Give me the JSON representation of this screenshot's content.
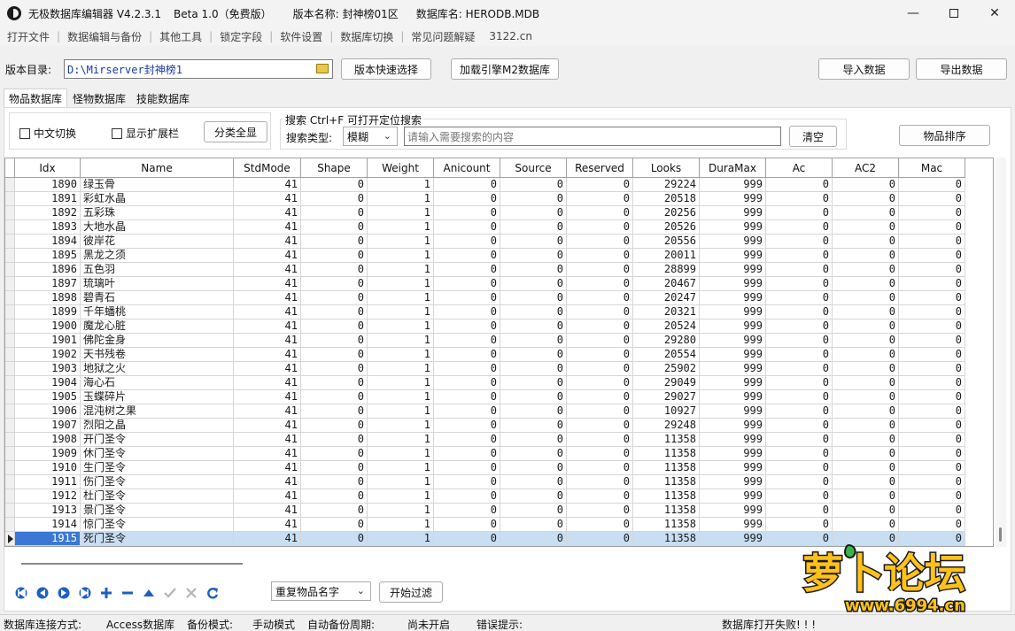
{
  "titlebar": {
    "app_name": "无极数据库编辑器 V4.2.3.1",
    "edition": "Beta 1.0（免费版）",
    "version_label": "版本名称: 封神榜01区",
    "db_label": "数据库名: HERODB.MDB",
    "minimize_icon": "minimize-icon",
    "maximize_icon": "maximize-icon",
    "close_icon": "close-icon"
  },
  "menu": [
    "打开文件",
    "数据编辑与备份",
    "其他工具",
    "锁定字段",
    "软件设置",
    "数据库切换",
    "常见问题解疑",
    "3122.cn"
  ],
  "toolbar": {
    "dir_label": "版本目录:",
    "dir_value": "D:\\Mirserver封神榜1",
    "quick_select": "版本快速选择",
    "load_m2": "加载引擎M2数据库",
    "import": "导入数据",
    "export": "导出数据"
  },
  "tabs": [
    "物品数据库",
    "怪物数据库",
    "技能数据库"
  ],
  "filters": {
    "chinese_switch": "中文切换",
    "show_ext": "显示扩展栏",
    "show_all": "分类全显",
    "search_title": "搜索  Ctrl+F 可打开定位搜索",
    "search_type_label": "搜索类型:",
    "search_type_value": "模糊",
    "search_placeholder": "请输入需要搜索的内容",
    "clear": "清空",
    "sort": "物品排序"
  },
  "grid": {
    "columns": [
      "Idx",
      "Name",
      "StdMode",
      "Shape",
      "Weight",
      "Anicount",
      "Source",
      "Reserved",
      "Looks",
      "DuraMax",
      "Ac",
      "AC2",
      "Mac"
    ],
    "rows": [
      [
        "1890",
        "绿玉骨",
        "41",
        "0",
        "1",
        "0",
        "0",
        "0",
        "29224",
        "999",
        "0",
        "0",
        "0"
      ],
      [
        "1891",
        "彩虹水晶",
        "41",
        "0",
        "1",
        "0",
        "0",
        "0",
        "20518",
        "999",
        "0",
        "0",
        "0"
      ],
      [
        "1892",
        "五彩珠",
        "41",
        "0",
        "1",
        "0",
        "0",
        "0",
        "20256",
        "999",
        "0",
        "0",
        "0"
      ],
      [
        "1893",
        "大地水晶",
        "41",
        "0",
        "1",
        "0",
        "0",
        "0",
        "20526",
        "999",
        "0",
        "0",
        "0"
      ],
      [
        "1894",
        "彼岸花",
        "41",
        "0",
        "1",
        "0",
        "0",
        "0",
        "20556",
        "999",
        "0",
        "0",
        "0"
      ],
      [
        "1895",
        "黑龙之须",
        "41",
        "0",
        "1",
        "0",
        "0",
        "0",
        "20011",
        "999",
        "0",
        "0",
        "0"
      ],
      [
        "1896",
        "五色羽",
        "41",
        "0",
        "1",
        "0",
        "0",
        "0",
        "28899",
        "999",
        "0",
        "0",
        "0"
      ],
      [
        "1897",
        "琉璃叶",
        "41",
        "0",
        "1",
        "0",
        "0",
        "0",
        "20467",
        "999",
        "0",
        "0",
        "0"
      ],
      [
        "1898",
        "碧青石",
        "41",
        "0",
        "1",
        "0",
        "0",
        "0",
        "20247",
        "999",
        "0",
        "0",
        "0"
      ],
      [
        "1899",
        "千年蟠桃",
        "41",
        "0",
        "1",
        "0",
        "0",
        "0",
        "20321",
        "999",
        "0",
        "0",
        "0"
      ],
      [
        "1900",
        "魔龙心脏",
        "41",
        "0",
        "1",
        "0",
        "0",
        "0",
        "20524",
        "999",
        "0",
        "0",
        "0"
      ],
      [
        "1901",
        "佛陀金身",
        "41",
        "0",
        "1",
        "0",
        "0",
        "0",
        "29280",
        "999",
        "0",
        "0",
        "0"
      ],
      [
        "1902",
        "天书残卷",
        "41",
        "0",
        "1",
        "0",
        "0",
        "0",
        "20554",
        "999",
        "0",
        "0",
        "0"
      ],
      [
        "1903",
        "地狱之火",
        "41",
        "0",
        "1",
        "0",
        "0",
        "0",
        "25902",
        "999",
        "0",
        "0",
        "0"
      ],
      [
        "1904",
        "海心石",
        "41",
        "0",
        "1",
        "0",
        "0",
        "0",
        "29049",
        "999",
        "0",
        "0",
        "0"
      ],
      [
        "1905",
        "玉蝶碎片",
        "41",
        "0",
        "1",
        "0",
        "0",
        "0",
        "29027",
        "999",
        "0",
        "0",
        "0"
      ],
      [
        "1906",
        "混沌树之果",
        "41",
        "0",
        "1",
        "0",
        "0",
        "0",
        "10927",
        "999",
        "0",
        "0",
        "0"
      ],
      [
        "1907",
        "烈阳之晶",
        "41",
        "0",
        "1",
        "0",
        "0",
        "0",
        "29248",
        "999",
        "0",
        "0",
        "0"
      ],
      [
        "1908",
        "开门圣令",
        "41",
        "0",
        "1",
        "0",
        "0",
        "0",
        "11358",
        "999",
        "0",
        "0",
        "0"
      ],
      [
        "1909",
        "休门圣令",
        "41",
        "0",
        "1",
        "0",
        "0",
        "0",
        "11358",
        "999",
        "0",
        "0",
        "0"
      ],
      [
        "1910",
        "生门圣令",
        "41",
        "0",
        "1",
        "0",
        "0",
        "0",
        "11358",
        "999",
        "0",
        "0",
        "0"
      ],
      [
        "1911",
        "伤门圣令",
        "41",
        "0",
        "1",
        "0",
        "0",
        "0",
        "11358",
        "999",
        "0",
        "0",
        "0"
      ],
      [
        "1912",
        "杜门圣令",
        "41",
        "0",
        "1",
        "0",
        "0",
        "0",
        "11358",
        "999",
        "0",
        "0",
        "0"
      ],
      [
        "1913",
        "景门圣令",
        "41",
        "0",
        "1",
        "0",
        "0",
        "0",
        "11358",
        "999",
        "0",
        "0",
        "0"
      ],
      [
        "1914",
        "惊门圣令",
        "41",
        "0",
        "1",
        "0",
        "0",
        "0",
        "11358",
        "999",
        "0",
        "0",
        "0"
      ],
      [
        "1915",
        "死门圣令",
        "41",
        "0",
        "1",
        "0",
        "0",
        "0",
        "11358",
        "999",
        "0",
        "0",
        "0"
      ]
    ],
    "selected_index": 25
  },
  "nav": {
    "icons": [
      "first-icon",
      "prior-icon",
      "next-icon",
      "last-icon",
      "insert-icon",
      "delete-icon",
      "edit-icon",
      "post-icon",
      "cancel-icon",
      "refresh-icon"
    ],
    "filter_value": "重复物品名字",
    "start_filter": "开始过滤"
  },
  "status": {
    "conn_label": "数据库连接方式:",
    "conn_value": "Access数据库",
    "backup_label": "备份模式:",
    "backup_value": "手动模式",
    "auto_label": "自动备份周期:",
    "auto_value": "尚未开启",
    "error_label": "错误提示:",
    "error_value": "数据库打开失败! ! !"
  },
  "watermark": {
    "brand": "萝卜论坛",
    "site": "www.6994.cn"
  },
  "colors": {
    "selection": "#c8def3",
    "selection_idx": "#3a78d4",
    "nav_blue": "#1f5fc4",
    "logo_yellow": "#ffc21a",
    "logo_dark": "#1a1a1a"
  }
}
